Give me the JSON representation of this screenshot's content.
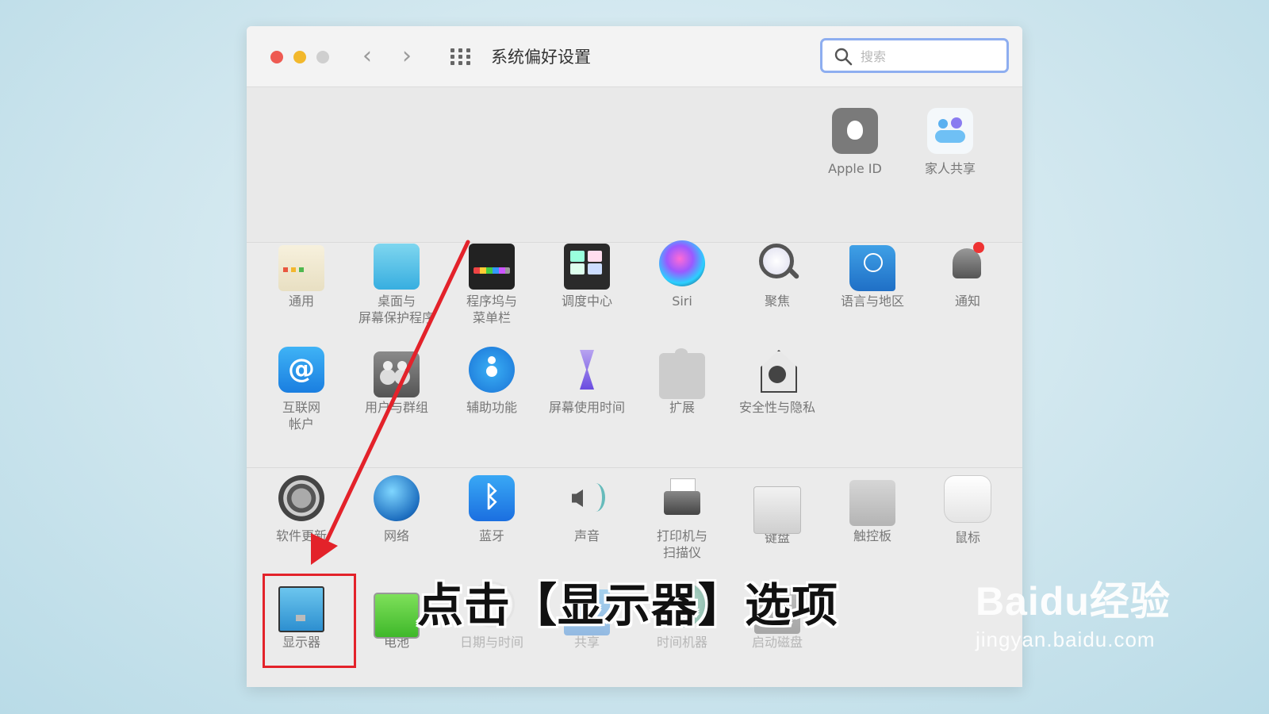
{
  "window": {
    "title": "系统偏好设置",
    "search_placeholder": "搜索"
  },
  "account_panes": [
    {
      "label": "Apple ID",
      "icon": "apple-id-icon"
    },
    {
      "label": "家人共享",
      "icon": "family-sharing-icon"
    }
  ],
  "row1": [
    {
      "lines": [
        "通用"
      ],
      "icon": "general-icon"
    },
    {
      "lines": [
        "桌面与",
        "屏幕保护程序"
      ],
      "icon": "desktop-screensaver-icon"
    },
    {
      "lines": [
        "程序坞与",
        "菜单栏"
      ],
      "icon": "dock-menubar-icon"
    },
    {
      "lines": [
        "调度中心"
      ],
      "icon": "mission-control-icon"
    },
    {
      "lines": [
        "Siri"
      ],
      "icon": "siri-icon"
    },
    {
      "lines": [
        "聚焦"
      ],
      "icon": "spotlight-icon"
    },
    {
      "lines": [
        "语言与地区"
      ],
      "icon": "language-region-icon"
    },
    {
      "lines": [
        "通知"
      ],
      "icon": "notifications-icon"
    }
  ],
  "row2": [
    {
      "lines": [
        "互联网",
        "帐户"
      ],
      "icon": "internet-accounts-icon"
    },
    {
      "lines": [
        "用户与群组"
      ],
      "icon": "users-groups-icon"
    },
    {
      "lines": [
        "辅助功能"
      ],
      "icon": "accessibility-icon"
    },
    {
      "lines": [
        "屏幕使用时间"
      ],
      "icon": "screen-time-icon"
    },
    {
      "lines": [
        "扩展"
      ],
      "icon": "extensions-icon"
    },
    {
      "lines": [
        "安全性与隐私"
      ],
      "icon": "security-privacy-icon"
    }
  ],
  "row3": [
    {
      "lines": [
        "软件更新"
      ],
      "icon": "software-update-icon"
    },
    {
      "lines": [
        "网络"
      ],
      "icon": "network-icon"
    },
    {
      "lines": [
        "蓝牙"
      ],
      "icon": "bluetooth-icon"
    },
    {
      "lines": [
        "声音"
      ],
      "icon": "sound-icon"
    },
    {
      "lines": [
        "打印机与",
        "扫描仪"
      ],
      "icon": "printers-scanners-icon"
    },
    {
      "lines": [
        "键盘"
      ],
      "icon": "keyboard-icon"
    },
    {
      "lines": [
        "触控板"
      ],
      "icon": "trackpad-icon"
    },
    {
      "lines": [
        "鼠标"
      ],
      "icon": "mouse-icon"
    }
  ],
  "row4": [
    {
      "lines": [
        "显示器"
      ],
      "icon": "displays-icon"
    },
    {
      "lines": [
        "电池"
      ],
      "icon": "battery-icon"
    },
    {
      "lines": [
        "日期与时间"
      ],
      "icon": "date-time-icon"
    },
    {
      "lines": [
        "共享"
      ],
      "icon": "sharing-icon"
    },
    {
      "lines": [
        "时间机器"
      ],
      "icon": "time-machine-icon"
    },
    {
      "lines": [
        "启动磁盘"
      ],
      "icon": "startup-disk-icon"
    }
  ],
  "caption": "点击【显示器】选项",
  "watermark": {
    "brand": "Baidu经验",
    "url": "jingyan.baidu.com"
  },
  "colors": {
    "highlight": "#e3222a",
    "search_border": "#8eaef0"
  }
}
